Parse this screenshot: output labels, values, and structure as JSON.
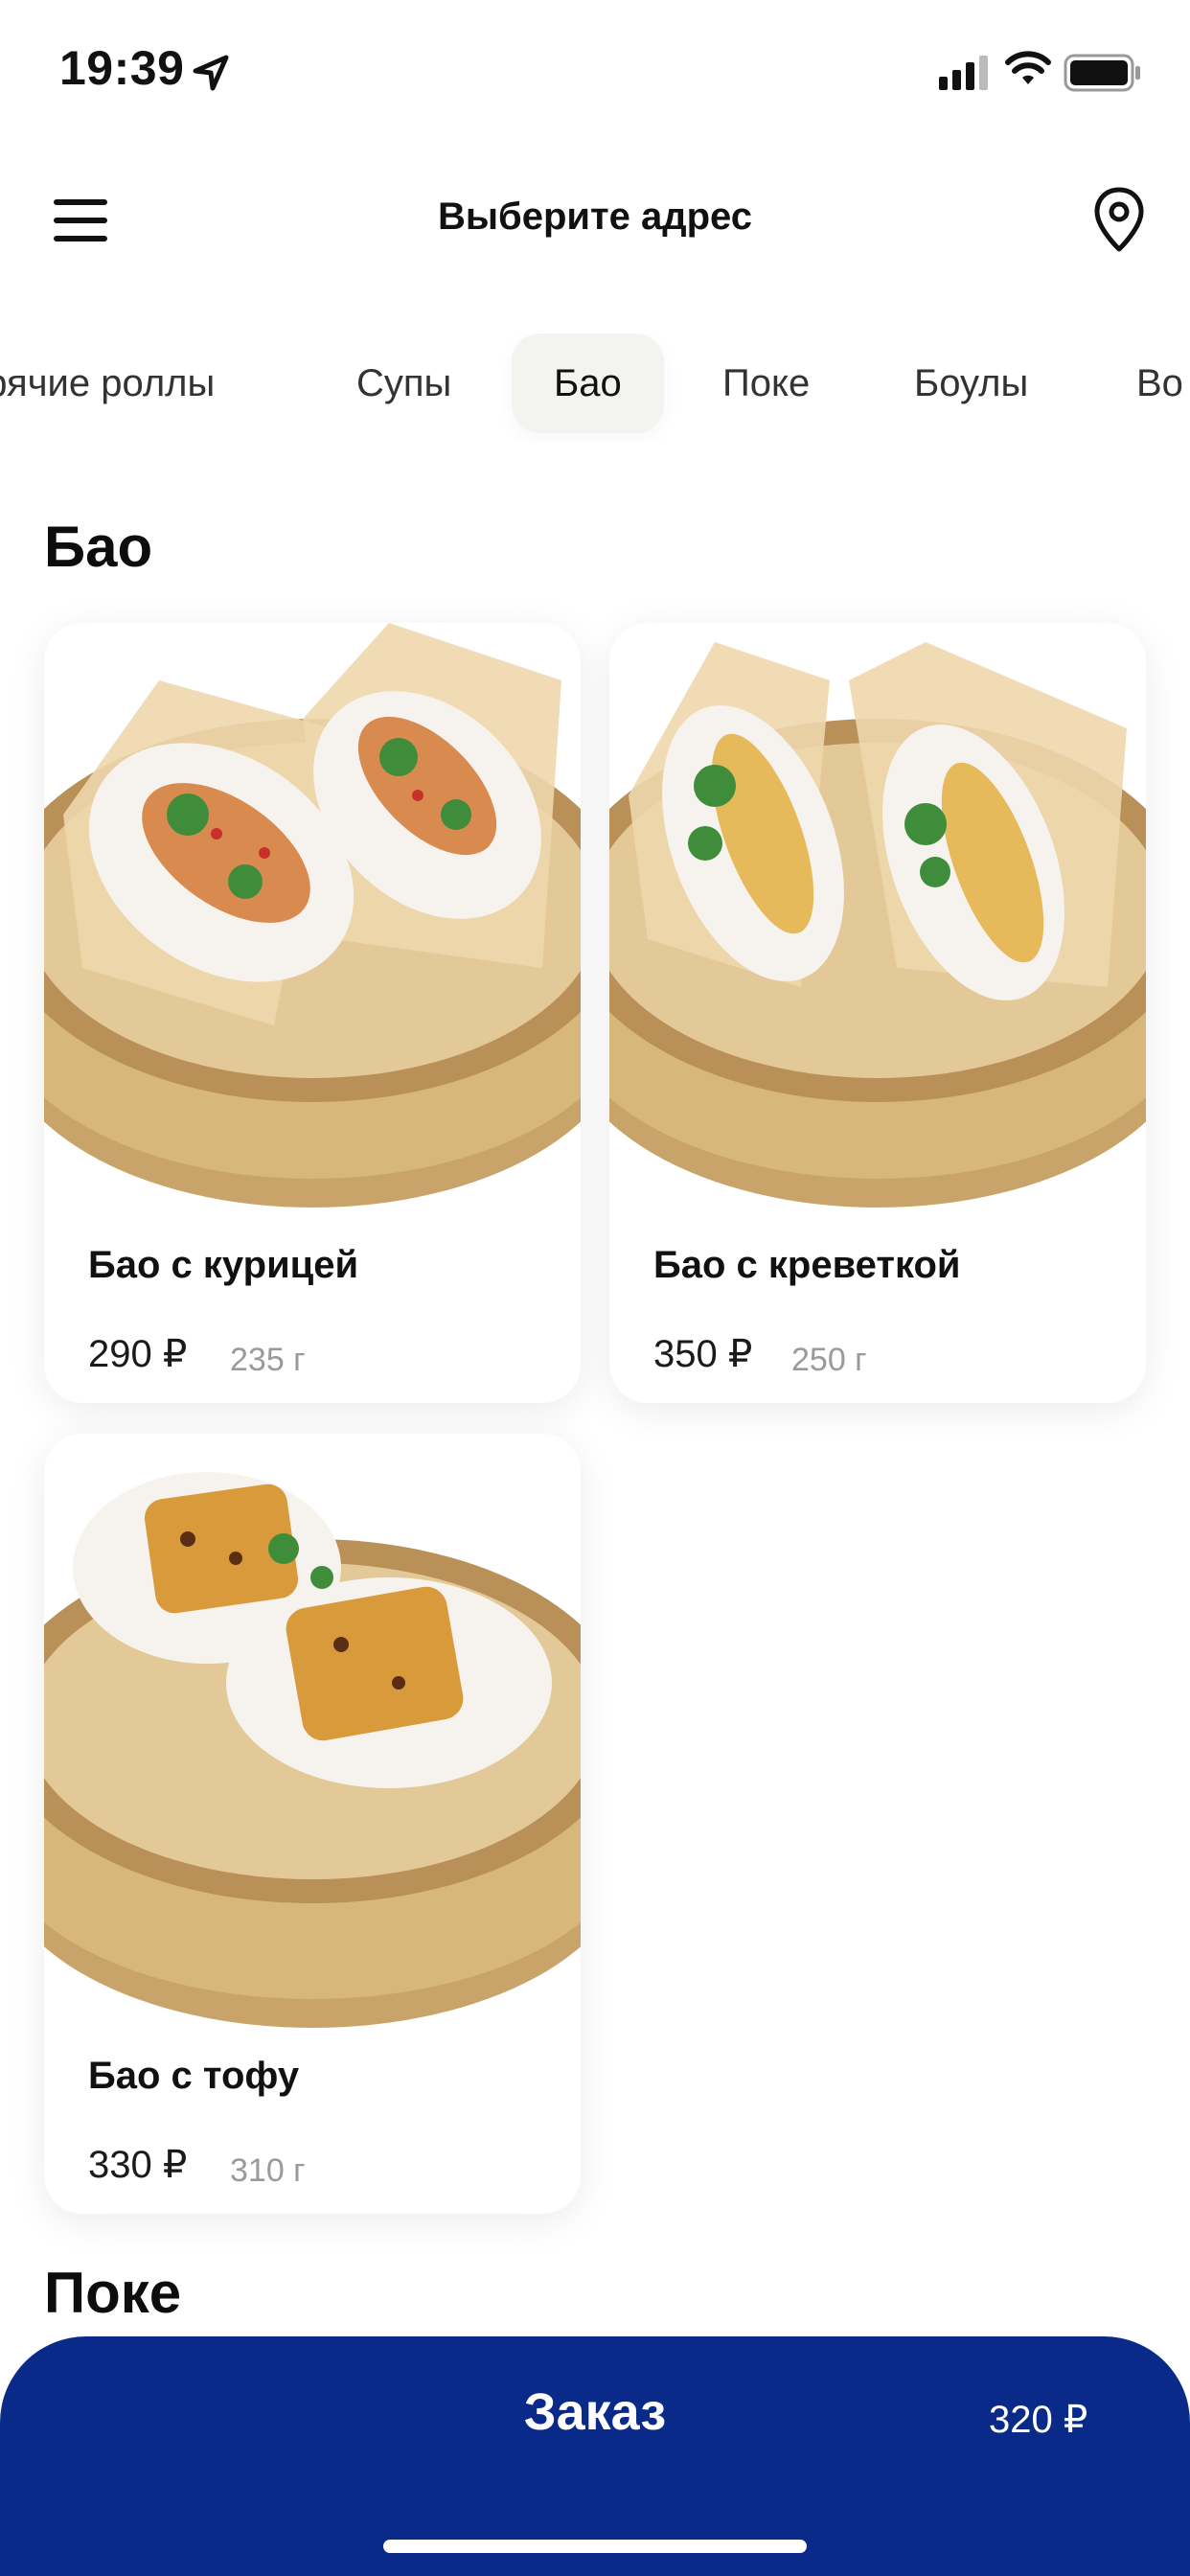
{
  "status": {
    "time": "19:39"
  },
  "header": {
    "title": "Выберите адрес"
  },
  "tabs": [
    {
      "label": "Горячие роллы"
    },
    {
      "label": "Супы"
    },
    {
      "label": "Бао"
    },
    {
      "label": "Поке"
    },
    {
      "label": "Боулы"
    },
    {
      "label": "Во"
    }
  ],
  "active_tab": "Бао",
  "sections": [
    {
      "title": "Бао",
      "items": [
        {
          "name": "Бао с курицей",
          "price": "290 ₽",
          "weight": "235 г"
        },
        {
          "name": "Бао с креветкой",
          "price": "350 ₽",
          "weight": "250 г"
        },
        {
          "name": "Бао с тофу",
          "price": "330 ₽",
          "weight": "310 г"
        }
      ]
    },
    {
      "title": "Поке"
    }
  ],
  "order": {
    "label": "Заказ",
    "total": "320 ₽"
  },
  "colors": {
    "accent": "#0a2a8a",
    "active_tab_bg": "#f3f3f0"
  }
}
